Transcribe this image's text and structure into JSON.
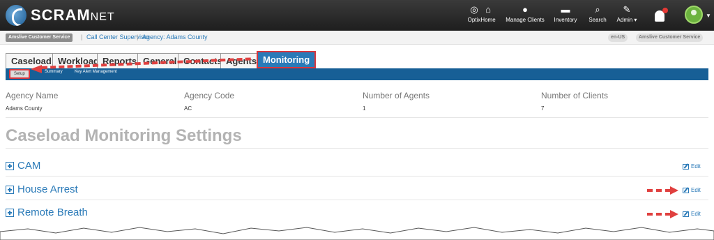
{
  "brand": {
    "name": "SCRAM",
    "suffix": "NET"
  },
  "nav": [
    {
      "label": "Optix",
      "icon": "dashboard-icon",
      "glyph": "◎"
    },
    {
      "label": "Home",
      "icon": "home-icon",
      "glyph": "⌂"
    },
    {
      "label": "Manage Clients",
      "icon": "user-icon",
      "glyph": "●"
    },
    {
      "label": "Inventory",
      "icon": "truck-icon",
      "glyph": "▬"
    },
    {
      "label": "Search",
      "icon": "search-icon",
      "glyph": "⌕"
    },
    {
      "label": "Admin ▾",
      "icon": "wrench-icon",
      "glyph": "✎"
    }
  ],
  "breadcrumb": {
    "org_badge": "Amslive Customer Service",
    "role": "Call Center Supervisor",
    "agency": "Agency: Adams County",
    "locale": "en-US",
    "org_right": "Amslive Customer Service"
  },
  "tabs": [
    "Caseload",
    "Workload",
    "Reports",
    "General",
    "Contacts",
    "Agents",
    "Monitoring"
  ],
  "active_tab": "Monitoring",
  "subtabs": [
    "Setup",
    "Summary",
    "Key Alert Management"
  ],
  "agency": {
    "name_label": "Agency Name",
    "name_value": "Adams County",
    "code_label": "Agency Code",
    "code_value": "AC",
    "agents_label": "Number of Agents",
    "agents_value": "1",
    "clients_label": "Number of Clients",
    "clients_value": "7"
  },
  "heading": "Caseload Monitoring Settings",
  "sections": [
    {
      "title": "CAM",
      "edit": "Edit"
    },
    {
      "title": "House Arrest",
      "edit": "Edit"
    },
    {
      "title": "Remote Breath",
      "edit": "Edit"
    }
  ],
  "colors": {
    "accent": "#2a7ab8",
    "band": "#175f96",
    "annotation": "#e0403f"
  }
}
